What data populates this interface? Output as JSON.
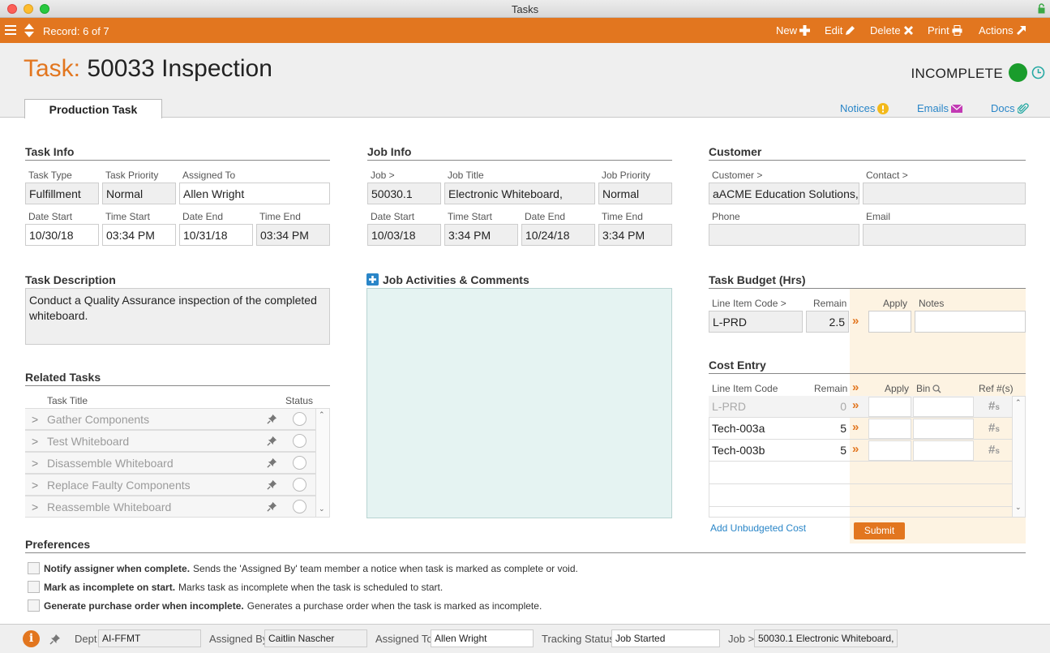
{
  "window": {
    "title": "Tasks"
  },
  "toolbar": {
    "record": "Record: 6 of 7",
    "new": "New",
    "edit": "Edit",
    "delete": "Delete",
    "print": "Print",
    "actions": "Actions"
  },
  "header": {
    "title_label": "Task:",
    "title_value": "50033 Inspection",
    "status": "INCOMPLETE",
    "status_color": "#1a9c2c",
    "tab": "Production Task",
    "links": {
      "notices": "Notices",
      "emails": "Emails",
      "docs": "Docs"
    }
  },
  "task_info": {
    "title": "Task Info",
    "labels": {
      "type": "Task Type",
      "priority": "Task Priority",
      "assigned": "Assigned To",
      "date_start": "Date Start",
      "time_start": "Time Start",
      "date_end": "Date End",
      "time_end": "Time End"
    },
    "type": "Fulfillment",
    "priority": "Normal",
    "assigned": "Allen Wright",
    "date_start": "10/30/18",
    "time_start": "03:34 PM",
    "date_end": "10/31/18",
    "time_end": "03:34 PM"
  },
  "job_info": {
    "title": "Job Info",
    "labels": {
      "job": "Job >",
      "job_title": "Job Title",
      "priority": "Job Priority",
      "date_start": "Date Start",
      "time_start": "Time Start",
      "date_end": "Date End",
      "time_end": "Time End"
    },
    "job": "50030.1",
    "job_title": "Electronic Whiteboard,",
    "priority": "Normal",
    "date_start": "10/03/18",
    "time_start": "3:34 PM",
    "date_end": "10/24/18",
    "time_end": "3:34 PM"
  },
  "customer": {
    "title": "Customer",
    "labels": {
      "customer": "Customer >",
      "contact": "Contact >",
      "phone": "Phone",
      "email": "Email"
    },
    "customer": "aACME Education Solutions,",
    "contact": "",
    "phone": "",
    "email": ""
  },
  "description": {
    "title": "Task Description",
    "text": "Conduct a Quality Assurance inspection of the completed whiteboard."
  },
  "activities": {
    "title": "Job Activities & Comments"
  },
  "related": {
    "title": "Related Tasks",
    "col_title": "Task Title",
    "col_status": "Status",
    "rows": [
      "Gather Components",
      "Test Whiteboard",
      "Disassemble Whiteboard",
      "Replace Faulty Components",
      "Reassemble Whiteboard"
    ]
  },
  "budget": {
    "title": "Task Budget (Hrs)",
    "cols": {
      "code": "Line Item Code >",
      "remain": "Remain",
      "apply": "Apply",
      "notes": "Notes"
    },
    "row": {
      "code": "L-PRD",
      "remain": "2.5"
    }
  },
  "cost_entry": {
    "title": "Cost Entry",
    "cols": {
      "code": "Line Item Code",
      "remain": "Remain",
      "apply": "Apply",
      "bin": "Bin",
      "ref": "Ref #(s)"
    },
    "rows": [
      {
        "code": "L-PRD",
        "remain": "0"
      },
      {
        "code": "Tech-003a",
        "remain": "5"
      },
      {
        "code": "Tech-003b",
        "remain": "5"
      }
    ],
    "add_link": "Add Unbudgeted Cost",
    "submit": "Submit"
  },
  "preferences": {
    "title": "Preferences",
    "items": [
      {
        "bold": "Notify assigner when complete.",
        "text": "Sends the 'Assigned By' team member a notice when task is marked as complete or void."
      },
      {
        "bold": "Mark as incomplete on start.",
        "text": "Marks task as incomplete when the task is scheduled to start."
      },
      {
        "bold": "Generate purchase order when incomplete.",
        "text": "Generates a purchase order when the task is marked as incomplete."
      }
    ]
  },
  "footer": {
    "dept_label": "Dept",
    "dept": "AI-FFMT",
    "assigned_by_label": "Assigned By",
    "assigned_by": "Caitlin Nascher",
    "assigned_to_label": "Assigned To",
    "assigned_to": "Allen Wright",
    "tracking_label": "Tracking Status",
    "tracking": "Job Started",
    "job_label": "Job >",
    "job": "50030.1 Electronic Whiteboard,"
  }
}
